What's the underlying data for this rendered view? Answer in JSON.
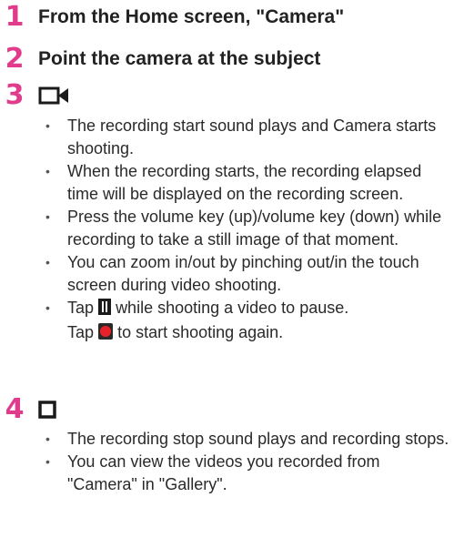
{
  "steps": [
    {
      "number": "1",
      "title": "From the Home screen, \"Camera\""
    },
    {
      "number": "2",
      "title": "Point the camera at the subject"
    },
    {
      "number": "3",
      "icon": "video-record-icon",
      "bullets": [
        "The recording start sound plays and Camera starts shooting.",
        "When the recording starts, the recording elapsed time will be displayed on the recording screen.",
        "Press the volume key (up)/volume key (down) while recording to take a still image of that moment.",
        "You can zoom in/out by pinching out/in the touch screen during video shooting."
      ],
      "pause_bullet": {
        "line1_a": "Tap",
        "line1_b": "while shooting a video to pause.",
        "line2_a": "Tap",
        "line2_b": "to start shooting again."
      }
    },
    {
      "number": "4",
      "icon": "stop-icon",
      "bullets": [
        "The recording stop sound plays and recording stops.",
        "You can view the videos you recorded from \"Camera\" in \"Gallery\"."
      ]
    }
  ],
  "colors": {
    "step_number": "#e13b8c",
    "record_dot": "#e8202a"
  },
  "icons": [
    "video-record-icon",
    "pause-icon",
    "record-icon",
    "stop-icon"
  ]
}
